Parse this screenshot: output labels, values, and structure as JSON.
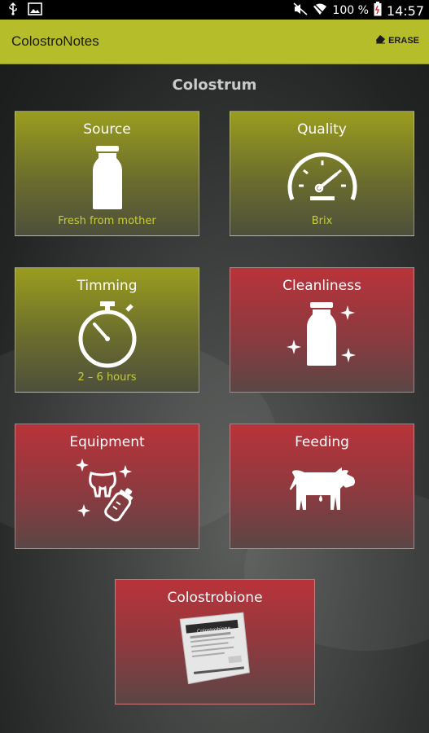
{
  "status_bar": {
    "battery": "100 %",
    "time": "14:57"
  },
  "app_bar": {
    "title": "ColostroNotes",
    "erase_label": "ERASE"
  },
  "section_title": "Colostrum",
  "tiles": [
    {
      "title": "Source",
      "subtitle": "Fresh from mother",
      "color": "green",
      "icon": "milk-bottle-icon"
    },
    {
      "title": "Quality",
      "subtitle": "Brix",
      "color": "green",
      "icon": "gauge-icon"
    },
    {
      "title": "Timming",
      "subtitle": "2 – 6 hours",
      "color": "green",
      "icon": "stopwatch-icon"
    },
    {
      "title": "Cleanliness",
      "subtitle": "",
      "color": "red",
      "icon": "sparkle-bottle-icon"
    },
    {
      "title": "Equipment",
      "subtitle": "",
      "color": "red",
      "icon": "udder-bottle-icon"
    },
    {
      "title": "Feeding",
      "subtitle": "",
      "color": "red",
      "icon": "cow-icon"
    },
    {
      "title": "Colostrobione",
      "subtitle": "",
      "color": "red",
      "icon": "product-package-icon"
    }
  ],
  "product_label": "Colostrobione",
  "colors": {
    "app_bar": "#b5bd2b",
    "tile_green": "#9a9d1e",
    "tile_red": "#b9333a",
    "subtitle": "#c8cc3a"
  }
}
